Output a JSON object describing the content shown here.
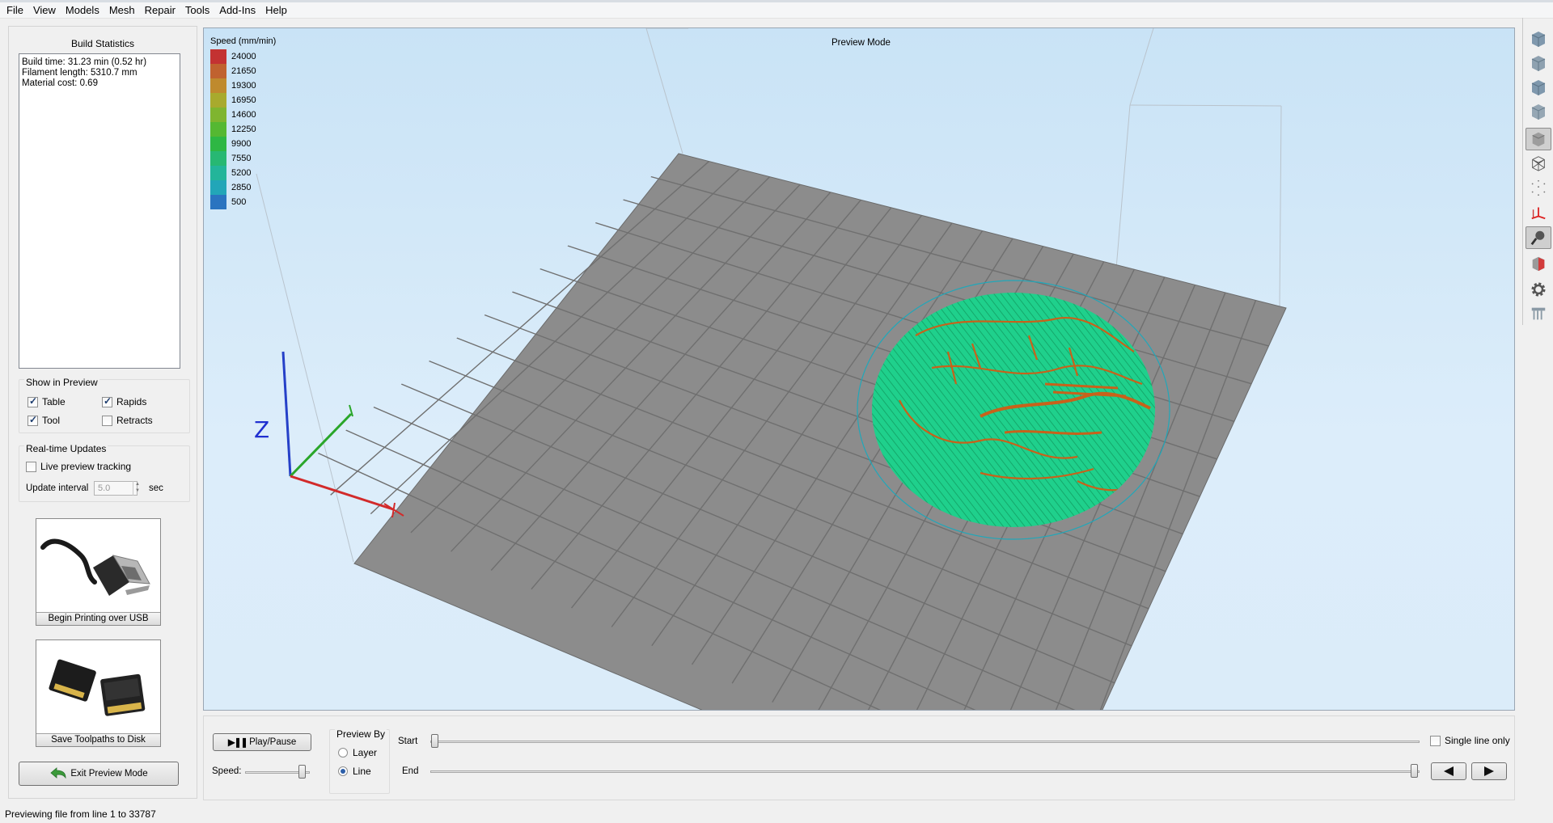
{
  "menu": [
    "File",
    "View",
    "Models",
    "Mesh",
    "Repair",
    "Tools",
    "Add-Ins",
    "Help"
  ],
  "left_panel": {
    "title": "Build Statistics",
    "stats": [
      "Build time: 31.23 min (0.52 hr)",
      "Filament length: 5310.7 mm",
      "Material cost: 0.69"
    ],
    "show_in_preview": {
      "title": "Show in Preview",
      "table": {
        "label": "Table",
        "checked": true
      },
      "rapids": {
        "label": "Rapids",
        "checked": true
      },
      "tool": {
        "label": "Tool",
        "checked": true
      },
      "retracts": {
        "label": "Retracts",
        "checked": false
      }
    },
    "realtime": {
      "title": "Real-time Updates",
      "live_tracking": {
        "label": "Live preview tracking",
        "checked": false
      },
      "interval_label": "Update interval",
      "interval_value": "5.0",
      "interval_unit": "sec"
    },
    "usb_button": "Begin Printing over USB",
    "save_button": "Save Toolpaths to Disk",
    "exit_button": "Exit Preview Mode"
  },
  "viewport": {
    "mode_label": "Preview Mode",
    "legend_title": "Speed (mm/min)",
    "legend": [
      {
        "value": "24000",
        "color": "#c33232"
      },
      {
        "value": "21650",
        "color": "#c0622f"
      },
      {
        "value": "19300",
        "color": "#bf8a2e"
      },
      {
        "value": "16950",
        "color": "#a8aa2d"
      },
      {
        "value": "14600",
        "color": "#7fb52f"
      },
      {
        "value": "12250",
        "color": "#55b832"
      },
      {
        "value": "9900",
        "color": "#2eb744"
      },
      {
        "value": "7550",
        "color": "#27b873"
      },
      {
        "value": "5200",
        "color": "#23b59a"
      },
      {
        "value": "2850",
        "color": "#22a6b8"
      },
      {
        "value": "500",
        "color": "#2a74c0"
      }
    ],
    "axis_z_label": "Z"
  },
  "right_toolbar": [
    "view-front-icon",
    "view-back-icon",
    "view-left-icon",
    "view-right-icon",
    "solid-view-icon",
    "wireframe-view-icon",
    "point-view-icon",
    "axes-icon",
    "light-icon",
    "clip-plane-icon",
    "settings-gear-icon",
    "supports-icon"
  ],
  "bottom": {
    "play_label": "Play/Pause",
    "speed_label": "Speed:",
    "preview_by_title": "Preview By",
    "layer_label": "Layer",
    "line_label": "Line",
    "preview_by_selected": "Line",
    "start_label": "Start",
    "end_label": "End",
    "single_line_label": "Single line only",
    "single_line_checked": false
  },
  "status": "Previewing file from line 1 to 33787"
}
